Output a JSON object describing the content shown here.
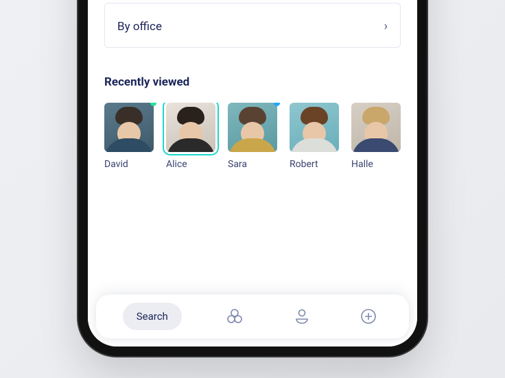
{
  "filterRow": {
    "label": "By office"
  },
  "sectionTitle": "Recently viewed",
  "people": [
    {
      "name": "David",
      "status": "green",
      "selected": false
    },
    {
      "name": "Alice",
      "status": null,
      "selected": true
    },
    {
      "name": "Sara",
      "status": "blue",
      "selected": false
    },
    {
      "name": "Robert",
      "status": null,
      "selected": false
    },
    {
      "name": "Halle",
      "status": null,
      "selected": false
    }
  ],
  "tabs": {
    "active": {
      "label": "Search",
      "icon": "search-icon"
    },
    "items": [
      {
        "icon": "circles-icon"
      },
      {
        "icon": "person-icon"
      },
      {
        "icon": "plus-icon"
      }
    ]
  },
  "colors": {
    "text": "#1b2559",
    "accentTeal": "#1fd6c9",
    "statusGreen": "#25e29a",
    "statusBlue": "#1aa8ff",
    "iconMuted": "#7d88ad"
  }
}
